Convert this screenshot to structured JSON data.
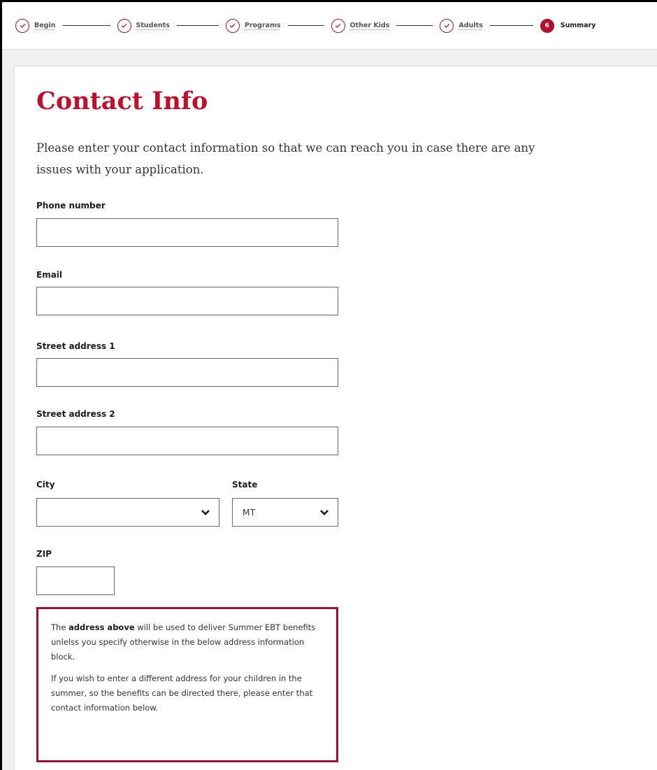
{
  "stepper": {
    "steps": [
      {
        "label": "Begin",
        "state": "complete"
      },
      {
        "label": "Students",
        "state": "complete"
      },
      {
        "label": "Programs",
        "state": "complete"
      },
      {
        "label": "Other Kids",
        "state": "complete"
      },
      {
        "label": "Adults",
        "state": "complete"
      },
      {
        "label": "Summary",
        "state": "current",
        "number": "6"
      }
    ],
    "accent_color": "#b50f2b"
  },
  "page": {
    "title": "Contact Info",
    "intro": "Please enter your contact information so that we can reach you in case there are any issues with your application."
  },
  "form": {
    "phone": {
      "label": "Phone number",
      "value": ""
    },
    "email": {
      "label": "Email",
      "value": ""
    },
    "street1": {
      "label": "Street address 1",
      "value": ""
    },
    "street2": {
      "label": "Street address 2",
      "value": ""
    },
    "city": {
      "label": "City",
      "value": ""
    },
    "state": {
      "label": "State",
      "value": "MT"
    },
    "zip": {
      "label": "ZIP",
      "value": ""
    }
  },
  "notice": {
    "p1_before": "The ",
    "p1_bold": "address above",
    "p1_after": " will be used to deliver Summer EBT benefits unlelss you specify otherwise in the below address information block.",
    "p2": "If you wish to enter a different address for your children in the summer, so the benefits can be directed there, please enter that contact information below.",
    "border_color": "#a3102c"
  }
}
